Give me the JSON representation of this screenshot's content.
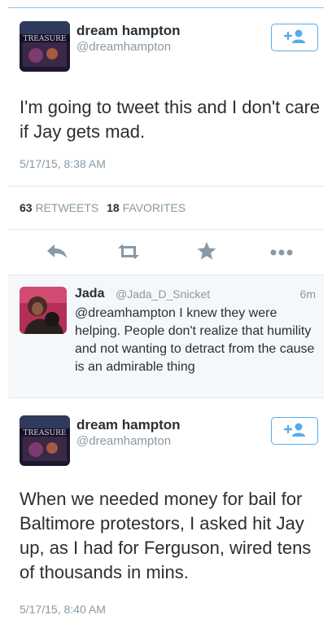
{
  "tweet1": {
    "name": "dream hampton",
    "handle": "@dreamhampton",
    "avatar_text": "TREASURE",
    "text": "I'm going to tweet this and I don't care if Jay gets mad.",
    "timestamp": "5/17/15, 8:38 AM",
    "follow_icon": "follow-plus-person-icon",
    "retweets_count": "63",
    "retweets_label": "RETWEETS",
    "favorites_count": "18",
    "favorites_label": "FAVORITES"
  },
  "actions": {
    "reply_icon": "reply-icon",
    "retweet_icon": "retweet-icon",
    "favorite_icon": "star-icon",
    "more_icon": "more-dots-icon"
  },
  "reply": {
    "name": "Jada",
    "handle": "@Jada_D_Snicket",
    "time": "6m",
    "text": "@dreamhampton I knew they were helping.  People don't realize that humility and not wanting to detract from the cause is an admirable thing"
  },
  "tweet2": {
    "name": "dream hampton",
    "handle": "@dreamhampton",
    "avatar_text": "TREASURE",
    "text": "When we needed money for bail for Baltimore protestors, I asked hit Jay up, as I had for Ferguson, wired tens of thousands in mins.",
    "timestamp": "5/17/15, 8:40 AM"
  },
  "colors": {
    "accent": "#55acee",
    "text": "#292f33",
    "muted": "#8899a6",
    "divider": "#e1e8ed",
    "reply_bg": "#f5f8fa"
  }
}
